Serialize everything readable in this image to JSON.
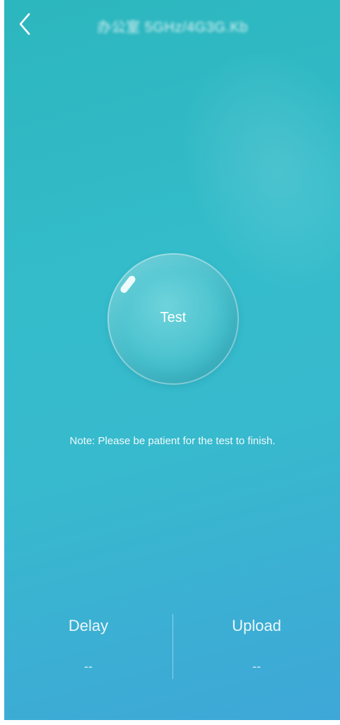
{
  "header": {
    "back_icon": "chevron-left-icon",
    "title": "办公室 5GHz/4G3G.Kb"
  },
  "test_button": {
    "label": "Test"
  },
  "note": "Note: Please be patient for the test to finish.",
  "stats": {
    "delay": {
      "label": "Delay",
      "value": "--"
    },
    "upload": {
      "label": "Upload",
      "value": "--"
    }
  },
  "colors": {
    "background_top": "#2cb6bd",
    "background_bottom": "#3ea7d8",
    "text": "#ffffff"
  }
}
